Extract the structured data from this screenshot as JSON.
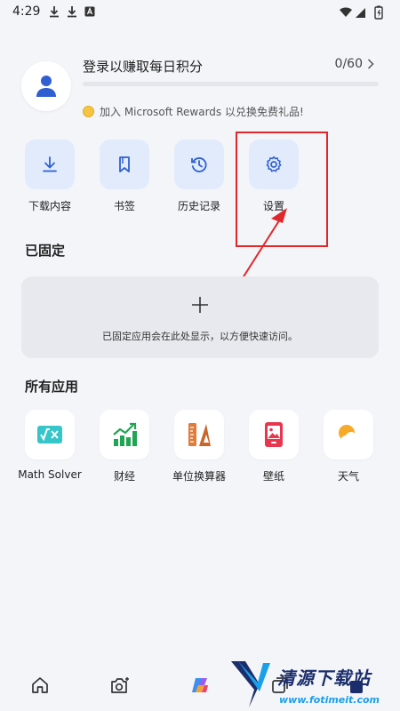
{
  "status_bar": {
    "time": "4:29"
  },
  "profile": {
    "login_text": "登录以赚取每日积分",
    "points": "0/60",
    "progress_fraction": 0,
    "rewards_text": "加入 Microsoft Rewards 以兑换免费礼品!"
  },
  "quick_actions": [
    {
      "label": "下载内容",
      "icon": "download-icon"
    },
    {
      "label": "书签",
      "icon": "bookmark-icon"
    },
    {
      "label": "历史记录",
      "icon": "history-icon"
    },
    {
      "label": "设置",
      "icon": "gear-icon"
    }
  ],
  "pinned": {
    "title": "已固定",
    "hint": "已固定应用会在此处显示，以方便快速访问。"
  },
  "apps": {
    "title": "所有应用",
    "items": [
      {
        "label": "Math Solver",
        "icon": "math-solver-icon"
      },
      {
        "label": "财经",
        "icon": "finance-icon"
      },
      {
        "label": "单位换算器",
        "icon": "unit-converter-icon"
      },
      {
        "label": "壁纸",
        "icon": "wallpaper-icon"
      },
      {
        "label": "天气",
        "icon": "weather-icon"
      }
    ]
  },
  "bottom_nav": [
    "home-icon",
    "camera-icon",
    "copilot-icon",
    "tabs-icon"
  ],
  "watermark": {
    "text": "清源下载站",
    "url": "www.fotimeit.com"
  },
  "colors": {
    "accent": "#3a73e0",
    "tile_bg": "#e1ebfb",
    "highlight": "#e0282b"
  }
}
